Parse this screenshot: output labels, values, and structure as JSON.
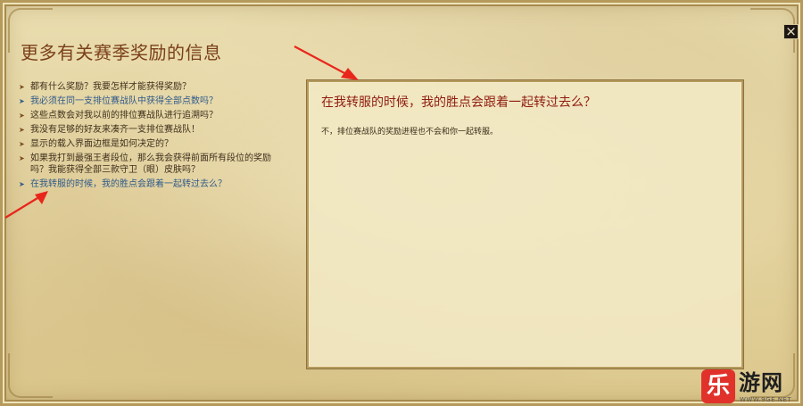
{
  "window": {
    "title": "更多有关赛季奖励的信息",
    "close_glyph": "×"
  },
  "faq": {
    "items": [
      {
        "label": "都有什么奖励？我要怎样才能获得奖励？",
        "style": "normal"
      },
      {
        "label": "我必须在同一支排位赛战队中获得全部点数吗？",
        "style": "link"
      },
      {
        "label": "这些点数会对我以前的排位赛战队进行追溯吗？",
        "style": "normal"
      },
      {
        "label": "我没有足够的好友来凑齐一支排位赛战队！",
        "style": "normal"
      },
      {
        "label": "显示的载入界面边框是如何决定的？",
        "style": "normal"
      },
      {
        "label": "如果我打到最强王者段位，那么我会获得前面所有段位的奖励吗？我能获得全部三款守卫（眼）皮肤吗？",
        "style": "normal"
      },
      {
        "label": "在我转服的时候，我的胜点会跟着一起转过去么？",
        "style": "link"
      }
    ]
  },
  "answer": {
    "title": "在我转服的时候，我的胜点会跟着一起转过去么？",
    "body": "不，排位赛战队的奖励进程也不会和你一起转服。"
  },
  "annotation": {
    "color": "#e8261c"
  },
  "watermark": {
    "badge": "乐",
    "name": "游网",
    "url": "WWW.9GE.NET"
  }
}
